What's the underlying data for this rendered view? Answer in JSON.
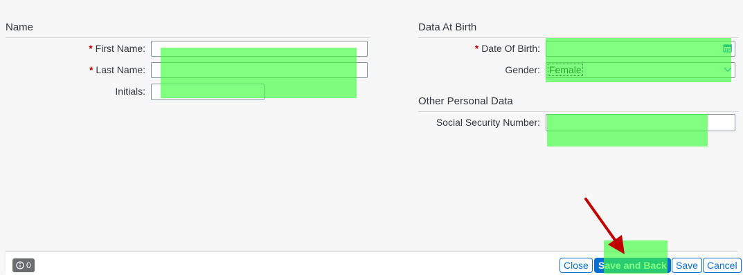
{
  "name_section": {
    "title": "Name",
    "first_name_label": "First Name:",
    "last_name_label": "Last Name:",
    "initials_label": "Initials:",
    "first_name_value": "",
    "last_name_value": "",
    "initials_value": ""
  },
  "birth_section": {
    "title": "Data At Birth",
    "dob_label": "Date Of Birth:",
    "dob_value": "",
    "gender_label": "Gender:",
    "gender_value": "Female"
  },
  "other_section": {
    "title": "Other Personal Data",
    "ssn_label": "Social Security Number:",
    "ssn_value": ""
  },
  "required_marker": "*",
  "footer": {
    "message_count": "0",
    "close_label": "Close",
    "save_and_back_label": "Save and Back",
    "save_label": "Save",
    "cancel_label": "Cancel"
  },
  "icons": {
    "info": "info-icon",
    "calendar": "calendar-icon",
    "dropdown": "chevron-down-icon",
    "annotation": "red-arrow"
  },
  "colors": {
    "accent": "#0a6ed1",
    "required": "#bb0000",
    "highlight": "#3cff3c",
    "annotation_arrow": "#c00000"
  }
}
